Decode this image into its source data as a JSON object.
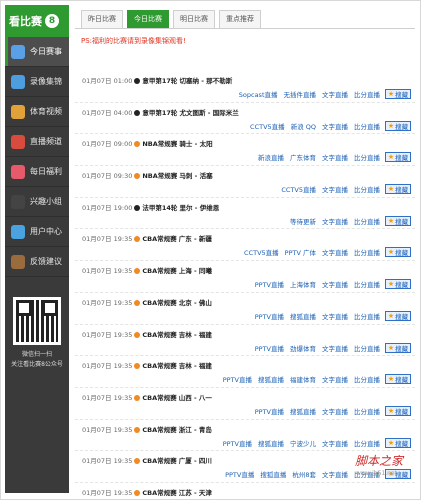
{
  "sidebar": {
    "logo_text": "看比赛",
    "logo_number": "8",
    "items": [
      {
        "label": "今日赛事",
        "icon": "list-icon",
        "color": "#5aa0e6",
        "active": true
      },
      {
        "label": "录像集锦",
        "icon": "film-icon",
        "color": "#4e9ddf"
      },
      {
        "label": "体育视频",
        "icon": "clapperboard-icon",
        "color": "#e2a23a"
      },
      {
        "label": "直播频道",
        "icon": "tv-icon",
        "color": "#d94c3d"
      },
      {
        "label": "每日福利",
        "icon": "gift-icon",
        "color": "#e65a6a"
      },
      {
        "label": "兴趣小组",
        "icon": "group-icon",
        "color": "#444444"
      },
      {
        "label": "用户中心",
        "icon": "user-icon",
        "color": "#4aa3df"
      },
      {
        "label": "反馈建议",
        "icon": "feedback-icon",
        "color": "#9a6b3d"
      }
    ],
    "qr_caption_line1": "微信扫一扫",
    "qr_caption_line2": "关注看比赛8公众号"
  },
  "tabs": [
    {
      "label": "昨日比赛",
      "active": false
    },
    {
      "label": "今日比赛",
      "active": true
    },
    {
      "label": "明日比赛",
      "active": false
    },
    {
      "label": "重点推荐",
      "active": false
    }
  ],
  "notice": "PS:福利的比赛请到录像集锦观看!",
  "bookmark_label": "搜藏",
  "matches": [
    {
      "time": "01月07日 01:00",
      "sport": "soccer",
      "league": "意甲第17轮",
      "teams": "切塞纳 - 那不勒斯",
      "links": [
        "Sopcast直播",
        "无插件直播",
        "文字直播",
        "比分直播"
      ]
    },
    {
      "time": "01月07日 04:00",
      "sport": "soccer",
      "league": "意甲第17轮",
      "teams": "尤文图斯 - 国际米兰",
      "links": [
        "CCTV5直播",
        "新浪 QQ",
        "文字直播",
        "比分直播"
      ]
    },
    {
      "time": "01月07日 09:00",
      "sport": "basketball",
      "league": "NBA常规赛",
      "teams": "骑士 - 太阳",
      "links": [
        "新浪直播",
        "广东体育",
        "文字直播",
        "比分直播"
      ]
    },
    {
      "time": "01月07日 09:30",
      "sport": "basketball",
      "league": "NBA常规赛",
      "teams": "马刺 - 活塞",
      "links": [
        "CCTV5直播",
        "文字直播",
        "比分直播"
      ]
    },
    {
      "time": "01月07日 19:00",
      "sport": "soccer",
      "league": "法甲第14轮",
      "teams": "里尔 - 伊维恩",
      "links": [
        "等待更新",
        "文字直播",
        "比分直播"
      ]
    },
    {
      "time": "01月07日 19:35",
      "sport": "basketball",
      "league": "CBA常规赛",
      "teams": "广东 - 新疆",
      "links": [
        "CCTV5直播",
        "PPTV 广体",
        "文字直播",
        "比分直播"
      ]
    },
    {
      "time": "01月07日 19:35",
      "sport": "basketball",
      "league": "CBA常规赛",
      "teams": "上海 - 同曦",
      "links": [
        "PPTV直播",
        "上海体育",
        "文字直播",
        "比分直播"
      ]
    },
    {
      "time": "01月07日 19:35",
      "sport": "basketball",
      "league": "CBA常规赛",
      "teams": "北京 - 佛山",
      "links": [
        "PPTV直播",
        "搜狐直播",
        "文字直播",
        "比分直播"
      ]
    },
    {
      "time": "01月07日 19:35",
      "sport": "basketball",
      "league": "CBA常规赛",
      "teams": "吉林 - 福建",
      "links": [
        "PPTV直播",
        "劲爆体育",
        "文字直播",
        "比分直播"
      ]
    },
    {
      "time": "01月07日 19:35",
      "sport": "basketball",
      "league": "CBA常规赛",
      "teams": "吉林 - 福建",
      "links": [
        "PPTV直播",
        "搜狐直播",
        "福建体育",
        "文字直播",
        "比分直播"
      ]
    },
    {
      "time": "01月07日 19:35",
      "sport": "basketball",
      "league": "CBA常规赛",
      "teams": "山西 - 八一",
      "links": [
        "PPTV直播",
        "搜狐直播",
        "文字直播",
        "比分直播"
      ]
    },
    {
      "time": "01月07日 19:35",
      "sport": "basketball",
      "league": "CBA常规赛",
      "teams": "浙江 - 青岛",
      "links": [
        "PPTV直播",
        "搜狐直播",
        "宁波少儿",
        "文字直播",
        "比分直播"
      ]
    },
    {
      "time": "01月07日 19:35",
      "sport": "basketball",
      "league": "CBA常规赛",
      "teams": "广厦 - 四川",
      "links": [
        "PPTV直播",
        "搜狐直播",
        "杭州8套",
        "文字直播",
        "比分直播"
      ]
    },
    {
      "time": "01月07日 19:35",
      "sport": "basketball",
      "league": "CBA常规赛",
      "teams": "江苏 - 天津",
      "links": [
        "PPTV直播",
        "文字直播",
        "比分直播"
      ]
    }
  ],
  "watermark": "脚本之家",
  "watermark_sub": "www.jb51.net"
}
